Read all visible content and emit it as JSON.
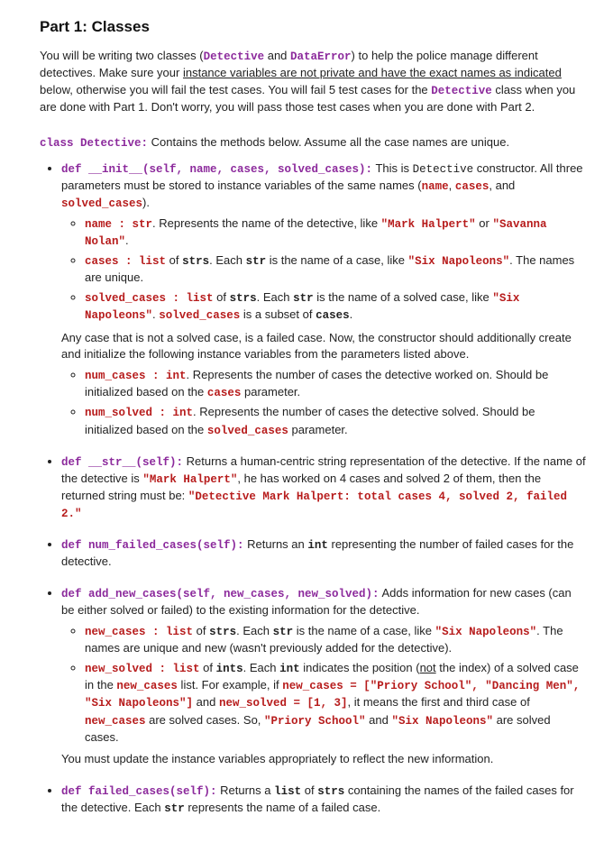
{
  "heading": "Part 1: Classes",
  "intro": {
    "t1": "You will be writing two classes (",
    "c1": "Detective",
    "t2": " and ",
    "c2": "DataError",
    "t3": ") to help the police manage different detectives. Make sure your ",
    "u1": "instance variables are not private and have the exact names as indicated",
    "t4": " below, otherwise you will fail the test cases. You will fail 5 test cases for the ",
    "c3": "Detective",
    "t5": " class when you are done with Part 1. Don't worry, you will pass those test cases when you are done with Part 2."
  },
  "classline": {
    "kw": "class Detective:",
    "rest": " Contains the methods below. Assume all the case names are unique."
  },
  "m_init": {
    "sig": "def __init__(self, name, cases, solved_cases):",
    "d1": " This is ",
    "d2": "Detective",
    "d3": " constructor. All three parameters must be stored to instance variables of the same names (",
    "p1": "name",
    "p2": "cases",
    "p3": "solved_cases",
    "d4": ").",
    "and": " and ",
    "comma": ", ",
    "sub": {
      "name": {
        "var": "name : str",
        "rest": ". Represents the name of the detective, like ",
        "e1": "\"Mark Halpert\"",
        "or": " or ",
        "e2": "\"Savanna Nolan\"",
        "end": "."
      },
      "cases": {
        "var": "cases : list",
        "of": " of ",
        "type": "strs",
        "rest": ". Each ",
        "type2": "str",
        "rest2": " is the name of a case, like ",
        "e1": "\"Six Napoleons\"",
        "end": ". The names are unique."
      },
      "solved": {
        "var": "solved_cases : list",
        "of": " of ",
        "type": "strs",
        "rest": ". Each ",
        "type2": "str",
        "rest2": " is the name of a solved case, like ",
        "e1": "\"Six Napoleons\"",
        "end": ". ",
        "sub": "solved_cases",
        "is": " is a subset of ",
        "c": "cases",
        "dot": "."
      },
      "note": "Any case that is not a solved case, is a failed case. Now, the constructor should additionally create and initialize the following instance variables from the parameters listed above.",
      "numcases": {
        "var": "num_cases : int",
        "rest": ". Represents the number of cases the detective worked on. Should be initialized based on the ",
        "p": "cases",
        "end": " parameter."
      },
      "numsolved": {
        "var": "num_solved : int",
        "rest": ". Represents the number of cases the detective solved. Should be initialized based on the ",
        "p": "solved_cases",
        "end": " parameter."
      }
    }
  },
  "m_str": {
    "sig": "def __str__(self):",
    "d1": " Returns a human-centric string representation of the detective. If the name of the detective is ",
    "e1": "\"Mark Halpert\"",
    "d2": ", he has worked on 4 cases and solved 2 of them, then the returned string must be: ",
    "e2": "\"Detective Mark Halpert: total cases 4, solved 2, failed 2.\""
  },
  "m_numfailed": {
    "sig": "def num_failed_cases(self):",
    "d1": " Returns an ",
    "t": "int",
    "d2": " representing the number of failed cases for the detective."
  },
  "m_add": {
    "sig": "def add_new_cases(self, new_cases, new_solved):",
    "d1": " Adds information for new cases (can be either solved or failed) to the existing information for the detective.",
    "nc": {
      "var": "new_cases : list",
      "of": " of ",
      "type": "strs",
      "rest": ". Each ",
      "type2": "str",
      "rest2": " is the name of a case, like ",
      "e1": "\"Six Napoleons\"",
      "end": ". The names are unique and new (wasn't previously added for the detective)."
    },
    "ns": {
      "var": "new_solved : list",
      "of": " of ",
      "type": "ints",
      "rest": ". Each ",
      "type2": "int",
      "rest2": " indicates the position (",
      "u": "not",
      "rest3": " the index) of a solved case in the ",
      "p1": "new_cases",
      "rest4": " list. For example, if ",
      "eq1": "new_cases = [\"Priory School\", \"Dancing Men\", \"Six Napoleons\"]",
      "and": " and ",
      "eq2": "new_solved = [1, 3]",
      "rest5": ", it means the first and third case of ",
      "p2": "new_cases",
      "rest6": " are solved cases. So, ",
      "e1": "\"Priory School\"",
      "and2": " and ",
      "e2": "\"Six Napoleons\"",
      "rest7": " are solved cases."
    },
    "tail": "You must update the instance variables appropriately to reflect the new information."
  },
  "m_failed": {
    "sig": "def failed_cases(self):",
    "d1": " Returns a ",
    "t1": "list",
    "d2": " of ",
    "t2": "strs",
    "d3": " containing the names of the failed cases for the detective. Each ",
    "t3": "str",
    "d4": " represents the name of a failed case."
  }
}
